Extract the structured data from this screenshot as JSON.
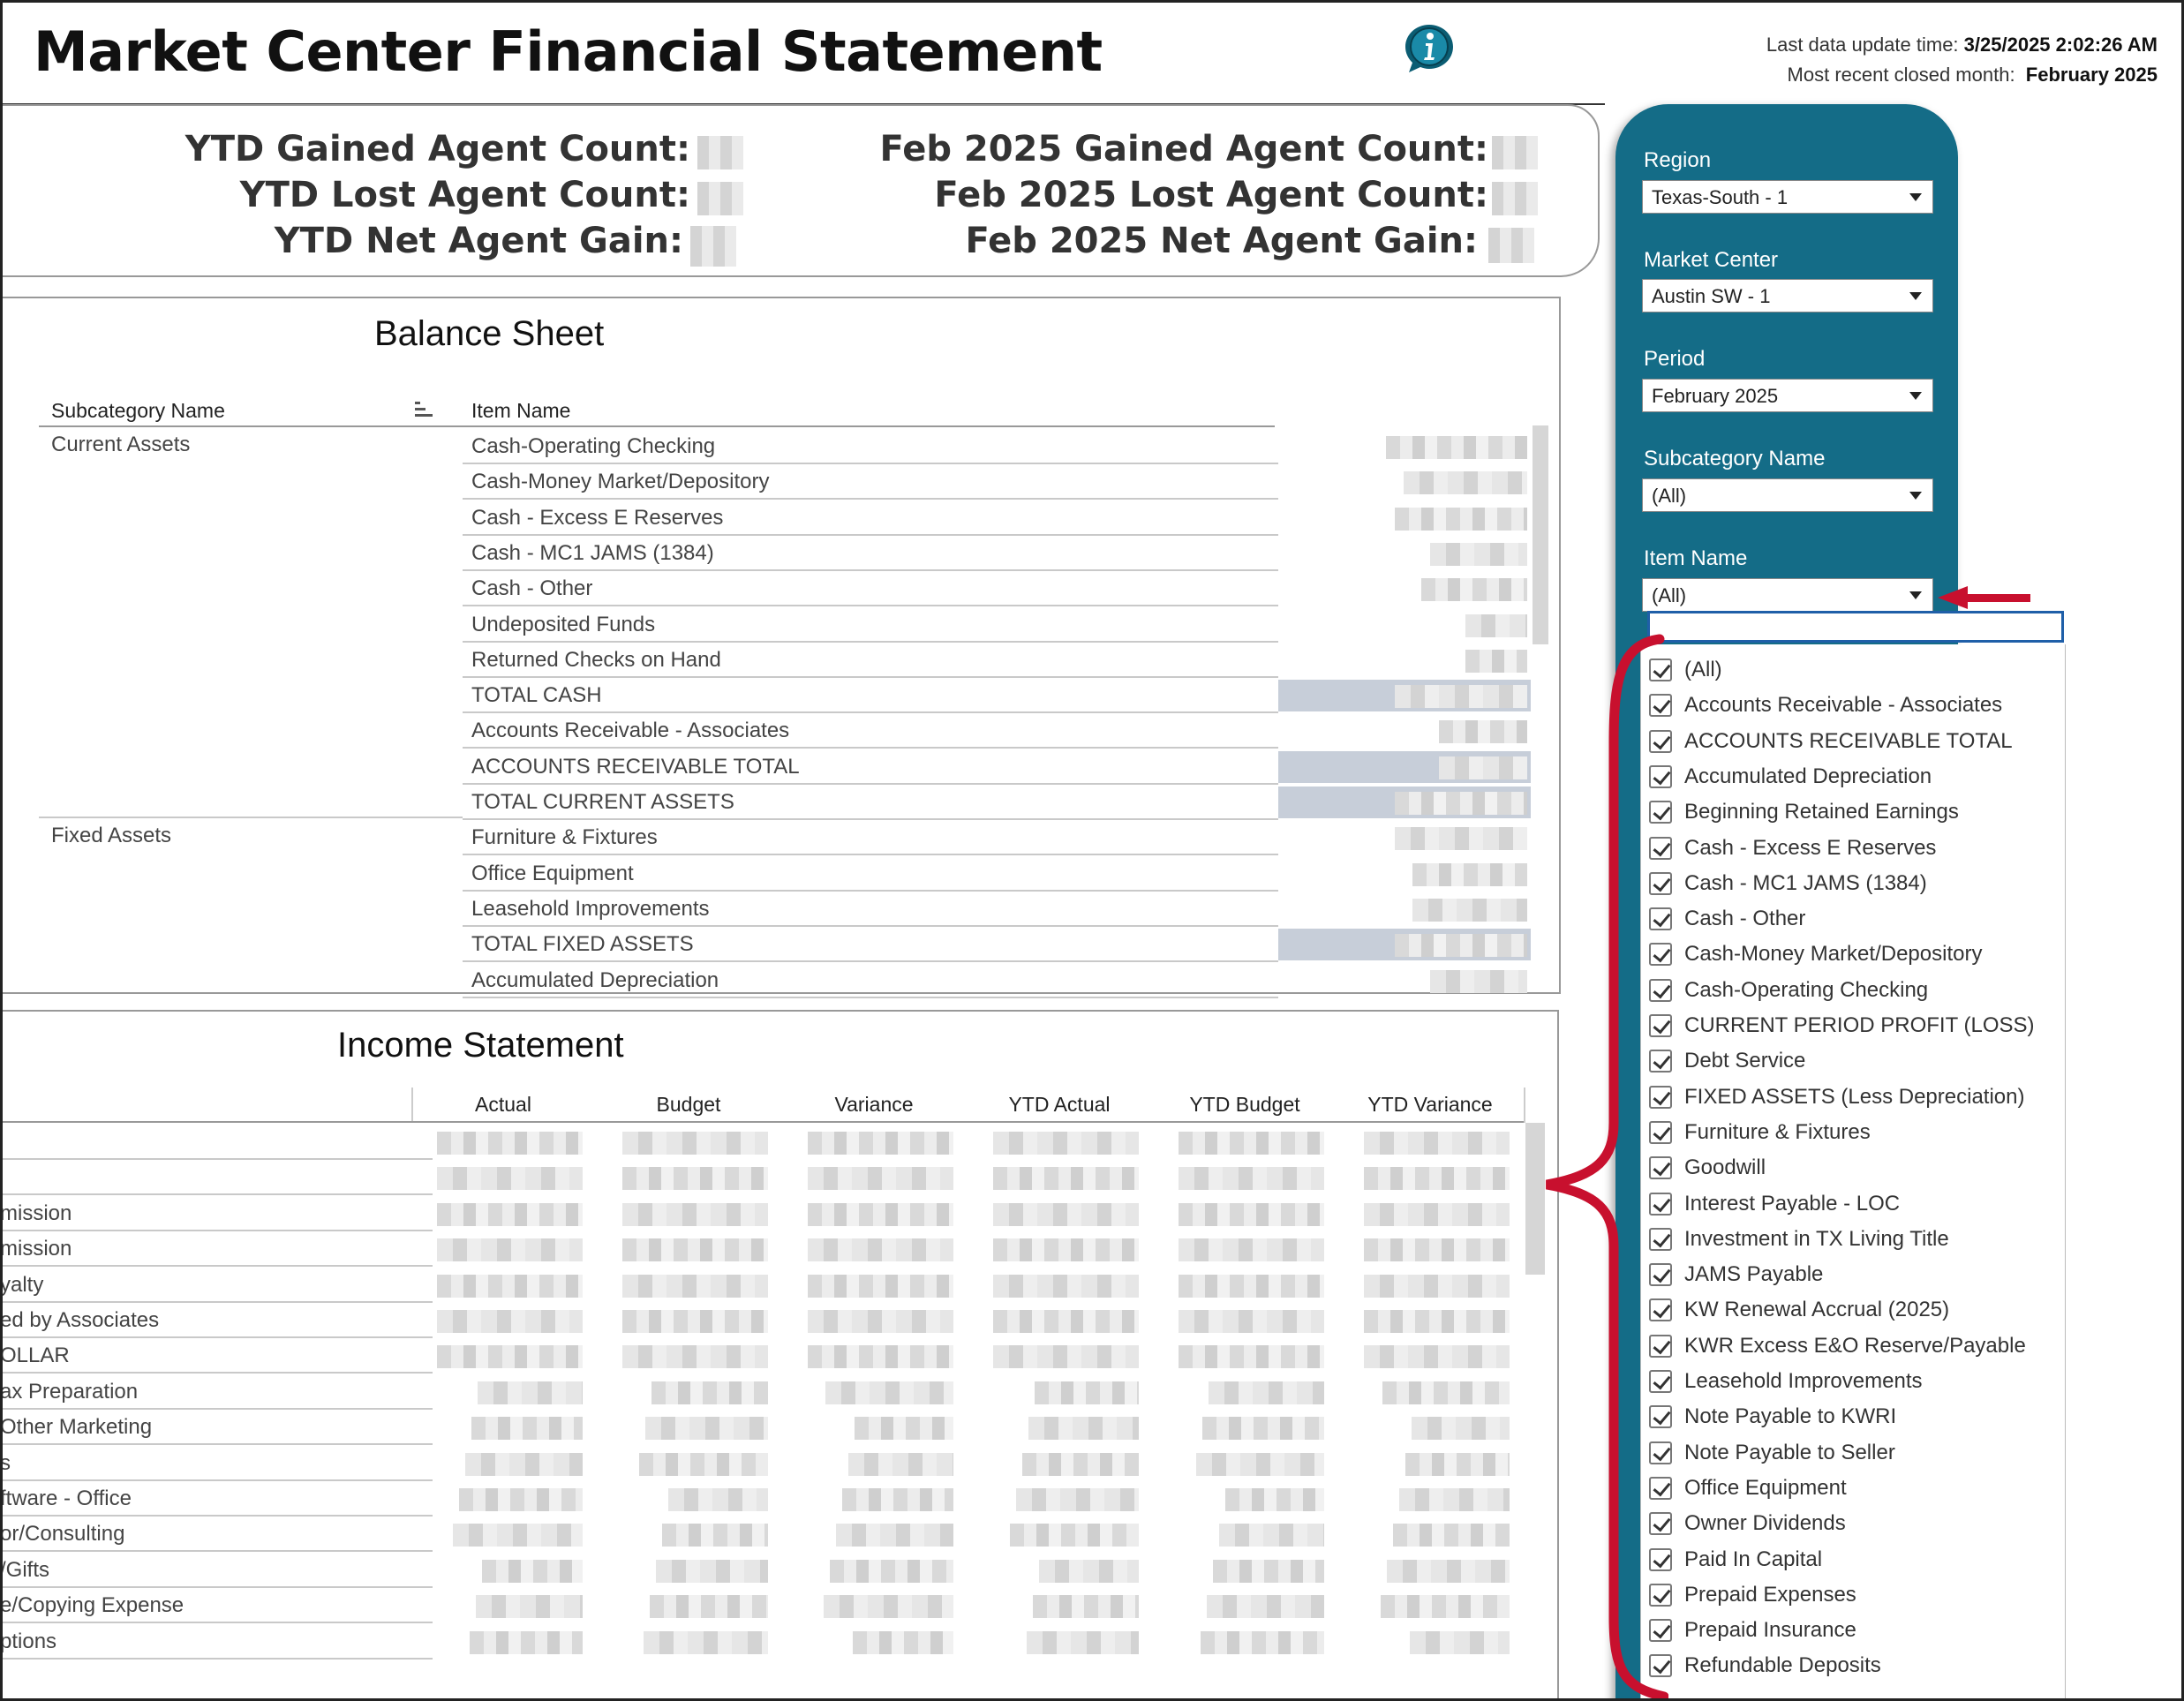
{
  "header": {
    "title": "Market Center Financial Statement",
    "last_update_label": "Last data update time:",
    "last_update_value": "3/25/2025 2:02:26 AM",
    "closed_month_label": "Most recent closed month:",
    "closed_month_value": "February 2025"
  },
  "kpis": {
    "ytd_gained": "YTD Gained Agent Count:",
    "ytd_lost": "YTD Lost Agent Count:",
    "ytd_net": "YTD Net Agent Gain:",
    "month_gained": "Feb 2025 Gained Agent Count:",
    "month_lost": "Feb 2025 Lost Agent Count:",
    "month_net": "Feb 2025 Net Agent Gain:"
  },
  "balance_sheet": {
    "title": "Balance Sheet",
    "col_subcategory": "Subcategory Name",
    "col_item": "Item Name",
    "subcategories": [
      "Current Assets",
      "Fixed Assets"
    ],
    "rows": [
      "Cash-Operating Checking",
      "Cash-Money Market/Depository",
      "Cash - Excess E Reserves",
      "Cash - MC1 JAMS (1384)",
      "Cash - Other",
      "Undeposited Funds",
      "Returned Checks on Hand",
      "TOTAL CASH",
      "Accounts Receivable - Associates",
      "ACCOUNTS RECEIVABLE TOTAL",
      "TOTAL CURRENT ASSETS",
      "Furniture & Fixtures",
      "Office Equipment",
      "Leasehold Improvements",
      "TOTAL FIXED ASSETS",
      "Accumulated Depreciation"
    ]
  },
  "income_statement": {
    "title": "Income Statement",
    "columns": [
      "Actual",
      "Budget",
      "Variance",
      "YTD Actual",
      "YTD Budget",
      "YTD Variance"
    ],
    "rows": [
      "",
      "",
      "mission",
      "mission",
      "yalty",
      "ed by Associates",
      "OLLAR",
      "ax Preparation",
      "Other Marketing",
      "s",
      "ftware - Office",
      "or/Consulting",
      "/Gifts",
      "e/Copying Expense",
      "ptions"
    ]
  },
  "filters": {
    "region_label": "Region",
    "region_value": "Texas-South - 1",
    "market_center_label": "Market Center",
    "market_center_value": "Austin SW - 1",
    "period_label": "Period",
    "period_value": "February 2025",
    "subcategory_label": "Subcategory Name",
    "subcategory_value": "(All)",
    "item_label": "Item Name",
    "item_value": "(All)"
  },
  "item_dropdown": {
    "search_value": "",
    "options": [
      "(All)",
      "Accounts Receivable - Associates",
      "ACCOUNTS RECEIVABLE TOTAL",
      "Accumulated Depreciation",
      "Beginning Retained Earnings",
      "Cash - Excess E Reserves",
      "Cash - MC1 JAMS (1384)",
      "Cash - Other",
      "Cash-Money Market/Depository",
      "Cash-Operating Checking",
      "CURRENT PERIOD PROFIT (LOSS)",
      "Debt Service",
      "FIXED ASSETS (Less Depreciation)",
      "Furniture & Fixtures",
      "Goodwill",
      "Interest Payable - LOC",
      "Investment in TX Living Title",
      "JAMS Payable",
      "KW Renewal Accrual (2025)",
      "KWR Excess E&O Reserve/Payable",
      "Leasehold Improvements",
      "Note Payable to KWRI",
      "Note Payable to Seller",
      "Office Equipment",
      "Owner Dividends",
      "Paid In Capital",
      "Prepaid Expenses",
      "Prepaid Insurance",
      "Refundable Deposits"
    ]
  },
  "colors": {
    "filter_panel": "#146c87",
    "annotation_red": "#c8102e",
    "total_row_shade": "#c7ced9"
  },
  "icons": {
    "info": "info-icon",
    "caret": "chevron-down-icon",
    "sort": "sort-icon",
    "checkbox": "checkbox-checked-icon"
  }
}
